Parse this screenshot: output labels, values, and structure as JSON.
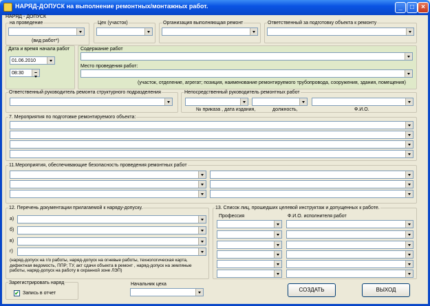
{
  "window": {
    "title": "НАРЯД-ДОПУСК на выполнение ремонтных/монтажных работ.",
    "minimize": "_",
    "maximize": "□",
    "close": "×"
  },
  "header": "НАРЯД - ДОПУСК",
  "top": {
    "na_provedenie": "на проведение",
    "vid_rabot": "(вид  работ*)",
    "ceh": "Цех (участок)",
    "org": "Организация выполняющая  ремонт",
    "otv_podg": "Ответственный за подготовку  объекта  к  ремонту"
  },
  "date": {
    "label": "Дата и время начала работ",
    "date_value": "01.06.2010",
    "time_value": "08:30"
  },
  "content": {
    "label": "Содержание работ",
    "place_label": "Место проведения работ:",
    "place_hint": "(участок, отделение, агрегат; позиция, наименование  ремонтируемого трубопровода, сооружения, здания, помещения)"
  },
  "heads": {
    "otv_ruk": "Ответственный руководитель ремонта структурного подразделения",
    "nep_ruk": "Непосредственный  руководитель ремонтных работ",
    "prikaz": "№  приказа , дата издания,",
    "dolzh": "должность,",
    "fio": "Ф.И.О."
  },
  "section7": "7. Мероприятия по подготовке  ремонтируемого объекта:",
  "section11": "11.Мероприятия, обеспечивающие  безопасность проведения ремонтных работ",
  "section12": {
    "title": "12. Перечень  документации прилагаемой  к наряду-допуску.",
    "items": [
      "а)",
      "б)",
      "в)",
      "г)"
    ],
    "note": "(наряд-допуск на г/о работы, наряд-допуск  на огневые работы, технологическая карта, дефектная ведомость, ППР; ТУ, акт сдачи объекта в ремонт , наряд-допуск на земляные работы, наряд-допуск на работу в охранной зоне ЛЭП)"
  },
  "section13": {
    "title": "13. Список  лиц, прошедших целевой инструктаж и допущенных к работе.",
    "col_prof": "Профессия",
    "col_fio": "Ф.И.О. исполнителя работ"
  },
  "register": {
    "label": "Зарегистрировать  наряд",
    "checkbox_label": "Запись в отчет",
    "checked": "✔"
  },
  "chief": {
    "label": "Начальник цеха"
  },
  "buttons": {
    "create": "СОЗДАТЬ",
    "exit": "ВЫХОД"
  }
}
